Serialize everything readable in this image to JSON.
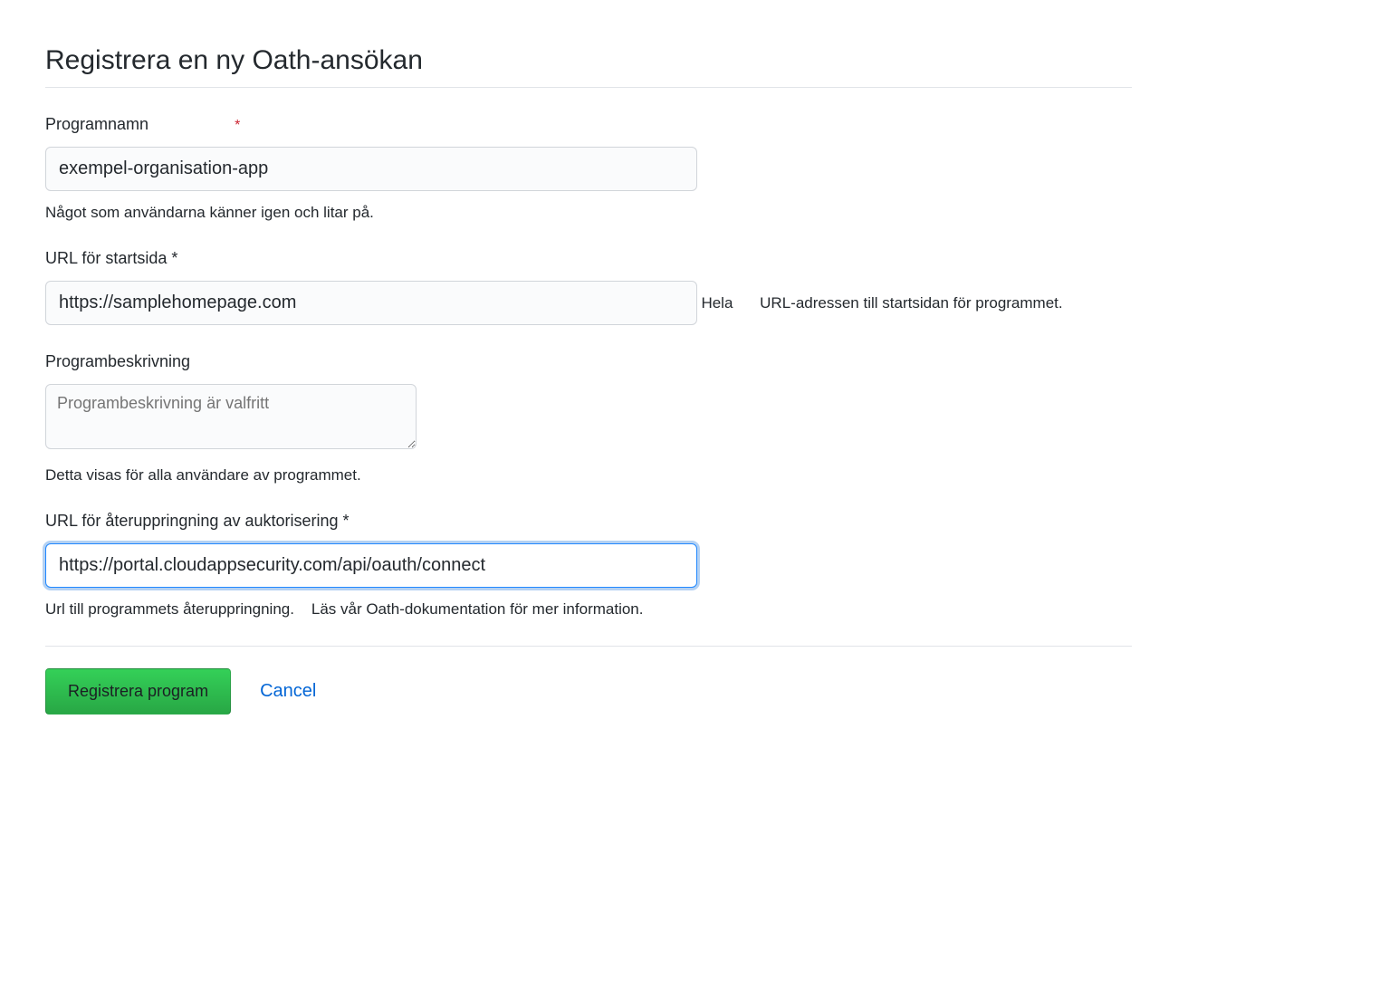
{
  "page": {
    "title": "Registrera en ny Oath-ansökan"
  },
  "form": {
    "appName": {
      "label": "Programnamn",
      "value": "exempel-organisation-app",
      "help": "Något som användarna känner igen och litar på."
    },
    "homepageUrl": {
      "label": "URL för startsida *",
      "value": "https://samplehomepage.com",
      "helpWord1": "Hela",
      "helpRest": "URL-adressen till startsidan för programmet."
    },
    "description": {
      "label": "Programbeskrivning",
      "placeholder": "Programbeskrivning är valfritt",
      "help": "Detta visas för alla användare av programmet."
    },
    "callbackUrl": {
      "label": "URL för återuppringning av auktorisering *",
      "value": "https://portal.cloudappsecurity.com/api/oauth/connect",
      "help1": "Url till programmets återuppringning.",
      "help2": "Läs vår Oath-dokumentation för mer information."
    }
  },
  "actions": {
    "register": "Registrera program",
    "cancel": "Cancel"
  }
}
